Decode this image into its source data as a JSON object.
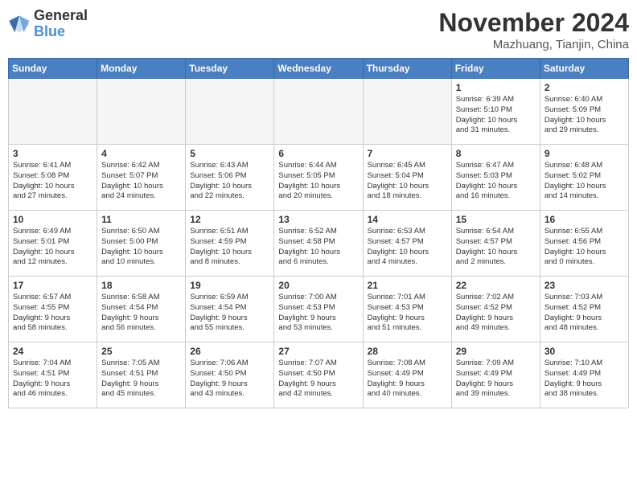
{
  "header": {
    "logo_line1": "General",
    "logo_line2": "Blue",
    "month": "November 2024",
    "location": "Mazhuang, Tianjin, China"
  },
  "weekdays": [
    "Sunday",
    "Monday",
    "Tuesday",
    "Wednesday",
    "Thursday",
    "Friday",
    "Saturday"
  ],
  "weeks": [
    [
      {
        "day": "",
        "info": ""
      },
      {
        "day": "",
        "info": ""
      },
      {
        "day": "",
        "info": ""
      },
      {
        "day": "",
        "info": ""
      },
      {
        "day": "",
        "info": ""
      },
      {
        "day": "1",
        "info": "Sunrise: 6:39 AM\nSunset: 5:10 PM\nDaylight: 10 hours\nand 31 minutes."
      },
      {
        "day": "2",
        "info": "Sunrise: 6:40 AM\nSunset: 5:09 PM\nDaylight: 10 hours\nand 29 minutes."
      }
    ],
    [
      {
        "day": "3",
        "info": "Sunrise: 6:41 AM\nSunset: 5:08 PM\nDaylight: 10 hours\nand 27 minutes."
      },
      {
        "day": "4",
        "info": "Sunrise: 6:42 AM\nSunset: 5:07 PM\nDaylight: 10 hours\nand 24 minutes."
      },
      {
        "day": "5",
        "info": "Sunrise: 6:43 AM\nSunset: 5:06 PM\nDaylight: 10 hours\nand 22 minutes."
      },
      {
        "day": "6",
        "info": "Sunrise: 6:44 AM\nSunset: 5:05 PM\nDaylight: 10 hours\nand 20 minutes."
      },
      {
        "day": "7",
        "info": "Sunrise: 6:45 AM\nSunset: 5:04 PM\nDaylight: 10 hours\nand 18 minutes."
      },
      {
        "day": "8",
        "info": "Sunrise: 6:47 AM\nSunset: 5:03 PM\nDaylight: 10 hours\nand 16 minutes."
      },
      {
        "day": "9",
        "info": "Sunrise: 6:48 AM\nSunset: 5:02 PM\nDaylight: 10 hours\nand 14 minutes."
      }
    ],
    [
      {
        "day": "10",
        "info": "Sunrise: 6:49 AM\nSunset: 5:01 PM\nDaylight: 10 hours\nand 12 minutes."
      },
      {
        "day": "11",
        "info": "Sunrise: 6:50 AM\nSunset: 5:00 PM\nDaylight: 10 hours\nand 10 minutes."
      },
      {
        "day": "12",
        "info": "Sunrise: 6:51 AM\nSunset: 4:59 PM\nDaylight: 10 hours\nand 8 minutes."
      },
      {
        "day": "13",
        "info": "Sunrise: 6:52 AM\nSunset: 4:58 PM\nDaylight: 10 hours\nand 6 minutes."
      },
      {
        "day": "14",
        "info": "Sunrise: 6:53 AM\nSunset: 4:57 PM\nDaylight: 10 hours\nand 4 minutes."
      },
      {
        "day": "15",
        "info": "Sunrise: 6:54 AM\nSunset: 4:57 PM\nDaylight: 10 hours\nand 2 minutes."
      },
      {
        "day": "16",
        "info": "Sunrise: 6:55 AM\nSunset: 4:56 PM\nDaylight: 10 hours\nand 0 minutes."
      }
    ],
    [
      {
        "day": "17",
        "info": "Sunrise: 6:57 AM\nSunset: 4:55 PM\nDaylight: 9 hours\nand 58 minutes."
      },
      {
        "day": "18",
        "info": "Sunrise: 6:58 AM\nSunset: 4:54 PM\nDaylight: 9 hours\nand 56 minutes."
      },
      {
        "day": "19",
        "info": "Sunrise: 6:59 AM\nSunset: 4:54 PM\nDaylight: 9 hours\nand 55 minutes."
      },
      {
        "day": "20",
        "info": "Sunrise: 7:00 AM\nSunset: 4:53 PM\nDaylight: 9 hours\nand 53 minutes."
      },
      {
        "day": "21",
        "info": "Sunrise: 7:01 AM\nSunset: 4:53 PM\nDaylight: 9 hours\nand 51 minutes."
      },
      {
        "day": "22",
        "info": "Sunrise: 7:02 AM\nSunset: 4:52 PM\nDaylight: 9 hours\nand 49 minutes."
      },
      {
        "day": "23",
        "info": "Sunrise: 7:03 AM\nSunset: 4:52 PM\nDaylight: 9 hours\nand 48 minutes."
      }
    ],
    [
      {
        "day": "24",
        "info": "Sunrise: 7:04 AM\nSunset: 4:51 PM\nDaylight: 9 hours\nand 46 minutes."
      },
      {
        "day": "25",
        "info": "Sunrise: 7:05 AM\nSunset: 4:51 PM\nDaylight: 9 hours\nand 45 minutes."
      },
      {
        "day": "26",
        "info": "Sunrise: 7:06 AM\nSunset: 4:50 PM\nDaylight: 9 hours\nand 43 minutes."
      },
      {
        "day": "27",
        "info": "Sunrise: 7:07 AM\nSunset: 4:50 PM\nDaylight: 9 hours\nand 42 minutes."
      },
      {
        "day": "28",
        "info": "Sunrise: 7:08 AM\nSunset: 4:49 PM\nDaylight: 9 hours\nand 40 minutes."
      },
      {
        "day": "29",
        "info": "Sunrise: 7:09 AM\nSunset: 4:49 PM\nDaylight: 9 hours\nand 39 minutes."
      },
      {
        "day": "30",
        "info": "Sunrise: 7:10 AM\nSunset: 4:49 PM\nDaylight: 9 hours\nand 38 minutes."
      }
    ]
  ]
}
